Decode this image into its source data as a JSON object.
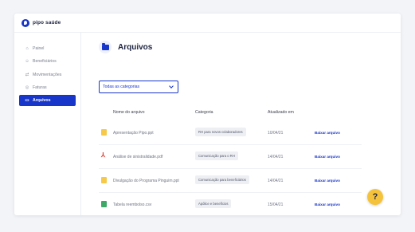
{
  "brand": {
    "name": "pipo saúde"
  },
  "sidebar": {
    "items": [
      {
        "label": "Painel",
        "icon": "home-icon",
        "active": false
      },
      {
        "label": "Beneficiários",
        "icon": "users-icon",
        "active": false
      },
      {
        "label": "Movimentações",
        "icon": "swap-icon",
        "active": false
      },
      {
        "label": "Faturas",
        "icon": "invoice-icon",
        "active": false
      },
      {
        "label": "Arquivos",
        "icon": "folder-icon",
        "active": true
      }
    ]
  },
  "main": {
    "title": "Arquivos",
    "filter": {
      "selected": "Todas as categorias"
    },
    "table": {
      "headers": {
        "name": "Nome do arquivo",
        "category": "Categoria",
        "updated": "Atualizado em"
      },
      "rows": [
        {
          "name": "Apresentação Pipo.ppt",
          "type": "ppt",
          "category": "RH para novos colaboradores",
          "date": "10/04/21",
          "action": "Baixar arquivo"
        },
        {
          "name": "Análise de sinistralidade.pdf",
          "type": "pdf",
          "category": "Comunicação para o RH",
          "date": "14/04/21",
          "action": "Baixar arquivo"
        },
        {
          "name": "Divulgação do Programa Pinguim.ppt",
          "type": "ppt",
          "category": "Comunicação para beneficiários",
          "date": "14/04/21",
          "action": "Baixar arquivo"
        },
        {
          "name": "Tabela reembolso.csv",
          "type": "csv",
          "category": "Apólice e benefícios",
          "date": "15/04/21",
          "action": "Baixar arquivo"
        }
      ]
    }
  },
  "help": {
    "label": "?"
  },
  "colors": {
    "primary": "#1836c9",
    "help": "#f5c33b",
    "ppt": "#f6c94b",
    "pdf": "#e0392f",
    "csv": "#3ea868"
  }
}
